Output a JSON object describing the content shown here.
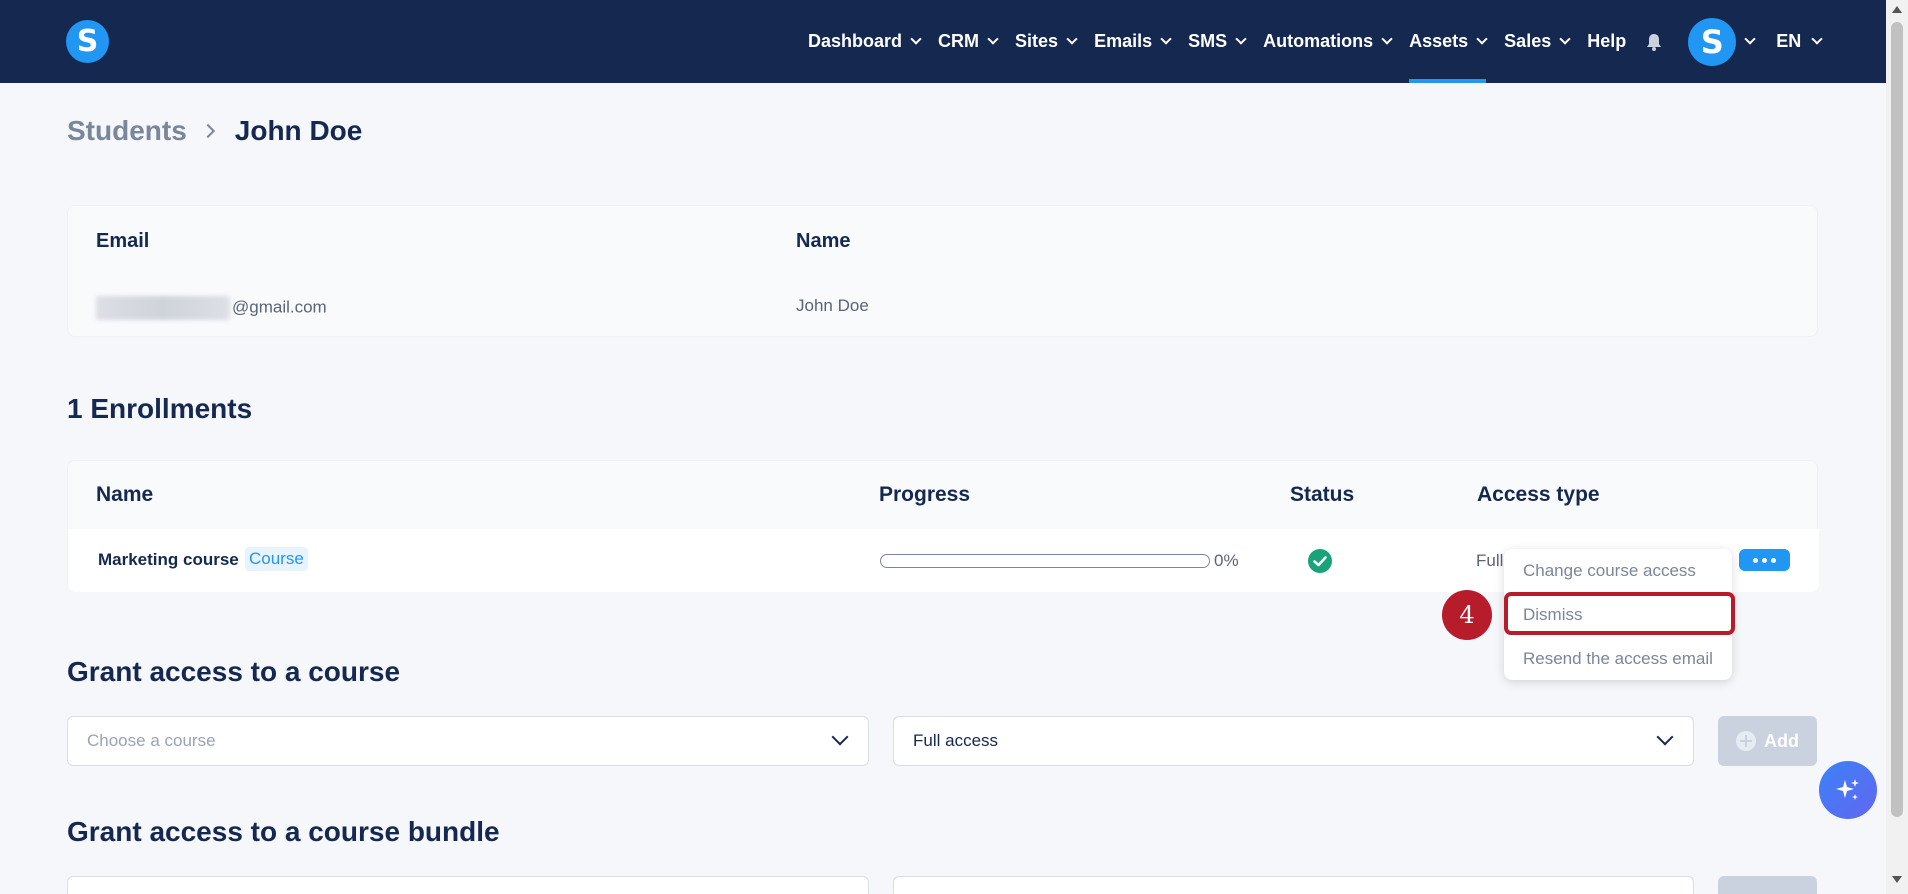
{
  "nav": {
    "logo_letter": "S",
    "items": [
      {
        "label": "Dashboard"
      },
      {
        "label": "CRM"
      },
      {
        "label": "Sites"
      },
      {
        "label": "Emails"
      },
      {
        "label": "SMS"
      },
      {
        "label": "Automations"
      },
      {
        "label": "Assets"
      },
      {
        "label": "Sales"
      }
    ],
    "help_label": "Help",
    "avatar_letter": "S",
    "language": "EN",
    "active_item": "Assets"
  },
  "breadcrumb": {
    "parent": "Students",
    "current": "John Doe"
  },
  "student": {
    "email_label": "Email",
    "email_value": "@gmail.com",
    "name_label": "Name",
    "name_value": "John Doe"
  },
  "enrollments": {
    "title": "1 Enrollments",
    "columns": {
      "name": "Name",
      "progress": "Progress",
      "status": "Status",
      "access_type": "Access type"
    },
    "rows": [
      {
        "course": "Marketing course",
        "badge": "Course",
        "progress_percent": 0,
        "progress_text": "0%",
        "status": "active",
        "access_type": "Full"
      }
    ]
  },
  "row_menu": {
    "items": [
      "Change course access",
      "Dismiss",
      "Resend the access email"
    ],
    "highlighted": "Dismiss",
    "step_number": "4"
  },
  "grant_course": {
    "title": "Grant access to a course",
    "course_placeholder": "Choose a course",
    "access_value": "Full access",
    "add_label": "Add"
  },
  "grant_bundle": {
    "title": "Grant access to a course bundle"
  },
  "colors": {
    "nav_bg": "#15284f",
    "accent": "#2196f3",
    "highlight": "#b71c2a",
    "status_ok": "#1aa37a"
  }
}
